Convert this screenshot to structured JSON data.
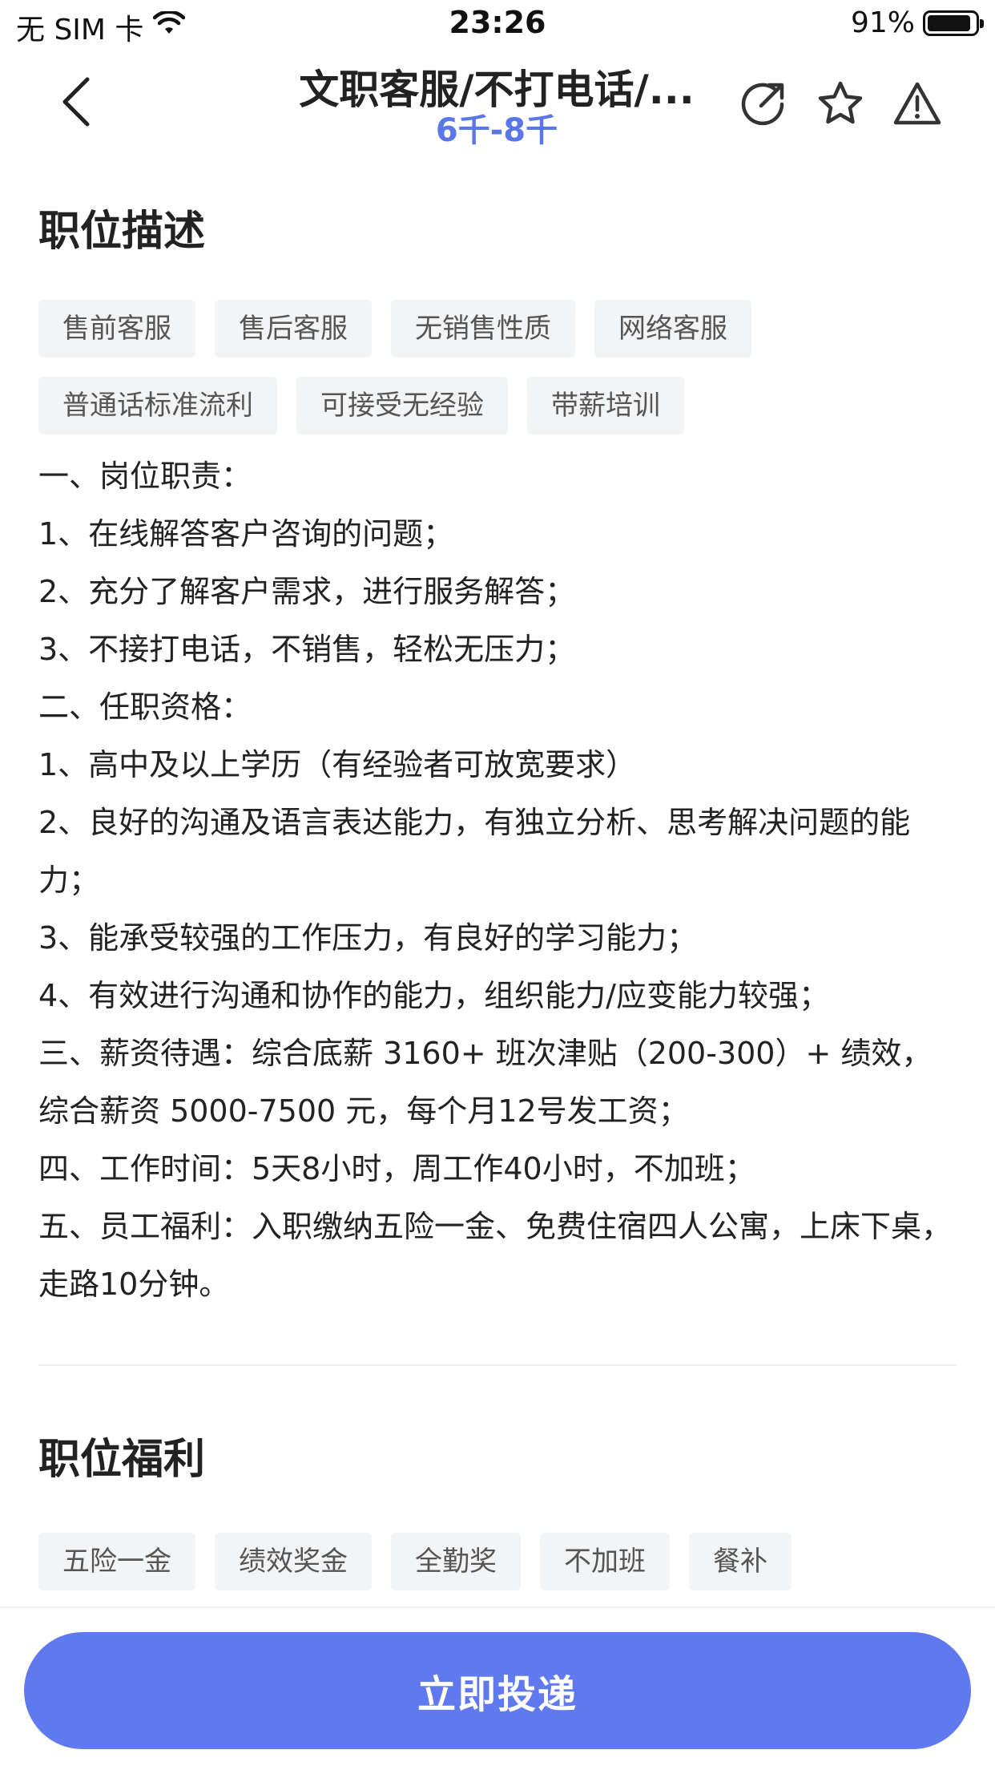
{
  "status": {
    "carrier": "无 SIM 卡",
    "time": "23:26",
    "battery": "91%"
  },
  "nav": {
    "title": "文职客服/不打电话/...",
    "salary": "6千-8千"
  },
  "description": {
    "title": "职位描述",
    "tags": [
      "售前客服",
      "售后客服",
      "无销售性质",
      "网络客服",
      "普通话标准流利",
      "可接受无经验",
      "带薪培训"
    ],
    "lines": [
      "一、岗位职责：",
      "1、在线解答客户咨询的问题；",
      "2、充分了解客户需求，进行服务解答；",
      "3、不接打电话，不销售，轻松无压力；",
      "二、任职资格：",
      "1、高中及以上学历（有经验者可放宽要求）",
      "2、良好的沟通及语言表达能力，有独立分析、思考解决问题的能力；",
      "3、能承受较强的工作压力，有良好的学习能力；",
      "4、有效进行沟通和协作的能力，组织能力/应变能力较强；",
      "三、薪资待遇：综合底薪 3160+ 班次津贴（200-300）+ 绩效，综合薪资 5000-7500 元，每个月12号发工资；",
      "四、工作时间：5天8小时，周工作40小时，不加班；",
      "五、员工福利：入职缴纳五险一金、免费住宿四人公寓，上床下桌，走路10分钟。"
    ]
  },
  "benefits": {
    "title": "职位福利",
    "tags": [
      "五险一金",
      "绩效奖金",
      "全勤奖",
      "不加班",
      "餐补"
    ]
  },
  "apply": {
    "label": "立即投递"
  },
  "colors": {
    "accent": "#6079ef",
    "salary": "#5b76e8",
    "tag_bg": "#f3f4f6"
  }
}
